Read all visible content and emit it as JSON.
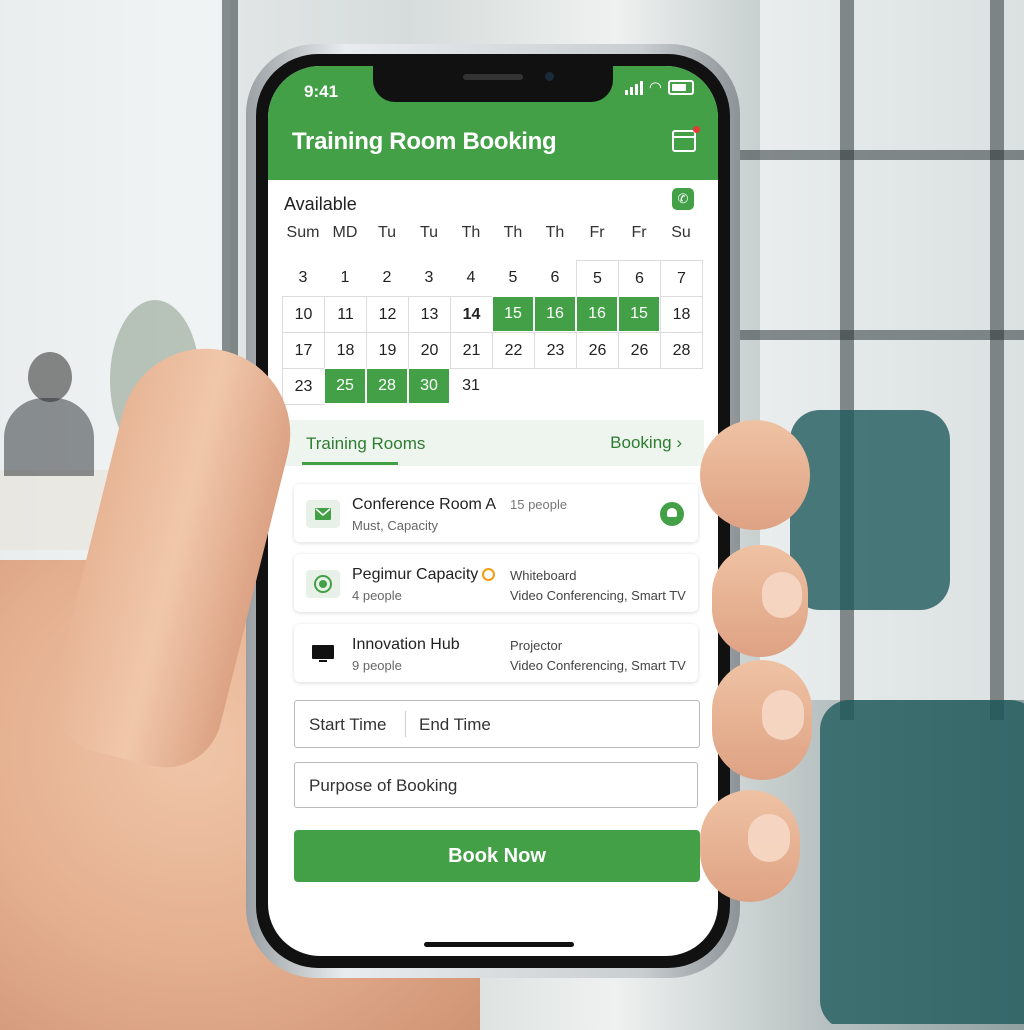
{
  "status_bar": {
    "time": "9:41"
  },
  "header": {
    "title": "Training Room Booking"
  },
  "calendar": {
    "label": "Available",
    "weekdays": [
      "Sum",
      "MD",
      "Tu",
      "Tu",
      "Th",
      "Th",
      "Th",
      "Fr",
      "Fr",
      "Su"
    ],
    "rows": [
      [
        "3",
        "1",
        "2",
        "3",
        "4",
        "5",
        "6",
        "5",
        "6",
        "7"
      ],
      [
        "10",
        "11",
        "12",
        "13",
        "14",
        "15",
        "16",
        "16",
        "15",
        "18"
      ],
      [
        "17",
        "18",
        "19",
        "20",
        "21",
        "22",
        "23",
        "26",
        "26",
        "28"
      ],
      [
        "23",
        "25",
        "28",
        "30",
        "31",
        "",
        "",
        "",
        "",
        "",
        ""
      ]
    ]
  },
  "tabs": {
    "rooms": "Training Rooms",
    "booking": "Booking ›"
  },
  "rooms": [
    {
      "name": "Conference Room A",
      "sub": "Must, Capacity",
      "extra1": "15 people",
      "extra2": ""
    },
    {
      "name": "Pegimur Capacity",
      "sub": "4 people",
      "extra1": "Whiteboard",
      "extra2": "Video Conferencing, Smart TV"
    },
    {
      "name": "Innovation Hub",
      "sub": "9 people",
      "extra1": "Projector",
      "extra2": "Video Conferencing, Smart TV"
    }
  ],
  "form": {
    "start_time": "Start Time",
    "end_time": "End Time",
    "purpose": "Purpose of Booking",
    "submit": "Book Now"
  },
  "colors": {
    "primary": "#43a047",
    "primary_dark": "#2e7d32",
    "accent_dot": "#f39c12"
  },
  "icons": [
    "calendar-icon",
    "phone-icon",
    "mail-icon",
    "radio-icon",
    "monitor-icon",
    "cloud-action-icon"
  ]
}
